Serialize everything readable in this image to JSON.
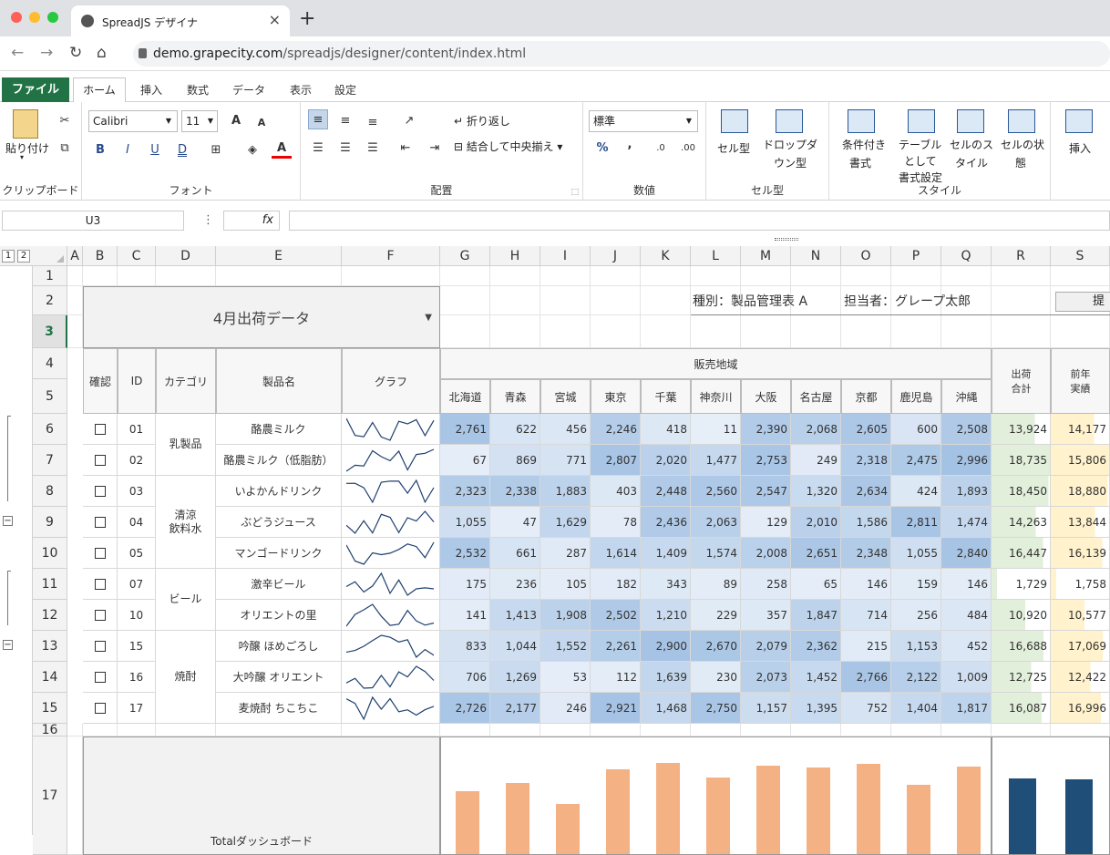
{
  "browser": {
    "tab_title": "SpreadJS デザイナ",
    "url_host": "demo.grapecity.com",
    "url_path": "/spreadjs/designer/content/index.html"
  },
  "menu": {
    "file": "ファイル",
    "tabs": [
      "ホーム",
      "挿入",
      "数式",
      "データ",
      "表示",
      "設定"
    ]
  },
  "ribbon": {
    "clipboard": {
      "paste": "貼り付け",
      "label": "クリップボード"
    },
    "font": {
      "name": "Calibri",
      "size": "11",
      "label": "フォント",
      "bold": "B",
      "italic": "I",
      "underline": "U",
      "dunderline": "D",
      "grow": "A",
      "shrink": "A"
    },
    "alignment": {
      "wrap": "折り返し",
      "merge": "結合して中央揃え",
      "label": "配置"
    },
    "number": {
      "format": "標準",
      "percent": "%",
      "comma": ",",
      "label": "数値"
    },
    "celltype": {
      "cell": "セル型",
      "dropdown1": "ドロップダ",
      "dropdown2": "ウン型",
      "label": "セル型"
    },
    "style": {
      "cond1": "条件付き",
      "cond2": "書式",
      "table1": "テーブル",
      "table2": "として",
      "table3": "書式設定",
      "cellstyle1": "セルのス",
      "cellstyle2": "タイル",
      "state1": "セルの状",
      "state2": "態",
      "label": "スタイル"
    },
    "insert": {
      "label": "挿入"
    }
  },
  "formula": {
    "namebox": "U3",
    "fx": "fx",
    "colon": "⋮"
  },
  "columns": [
    "A",
    "B",
    "C",
    "D",
    "E",
    "F",
    "G",
    "H",
    "I",
    "J",
    "K",
    "L",
    "M",
    "N",
    "O",
    "P",
    "Q",
    "R",
    "S"
  ],
  "rows": [
    "1",
    "2",
    "3",
    "4",
    "5",
    "6",
    "7",
    "8",
    "9",
    "10",
    "11",
    "12",
    "13",
    "14",
    "15",
    "16",
    "17"
  ],
  "outline": [
    "1",
    "2"
  ],
  "sheet": {
    "title": "4月出荷データ",
    "kind": "種別：製品管理表 A",
    "person": "担当者：グレープ太郎",
    "btn": "提",
    "headers": {
      "check": "確認",
      "id": "ID",
      "category": "カテゴリ",
      "product": "製品名",
      "graph": "グラフ",
      "region": "販売地域",
      "total1": "出荷",
      "total2": "合計",
      "prev1": "前年",
      "prev2": "実績"
    },
    "regions": [
      "北海道",
      "青森",
      "宮城",
      "東京",
      "千葉",
      "神奈川",
      "大阪",
      "名古屋",
      "京都",
      "鹿児島",
      "沖縄"
    ],
    "categories": [
      {
        "name": "乳製品",
        "rows": 2
      },
      {
        "name": "清涼\n飲料水",
        "rows": 3
      },
      {
        "name": "ビール",
        "rows": 2
      },
      {
        "name": "焼酎",
        "rows": 3
      }
    ],
    "products": [
      {
        "id": "01",
        "name": "酪農ミルク",
        "vals": [
          "2,761",
          "622",
          "456",
          "2,246",
          "418",
          "11",
          "2,390",
          "2,068",
          "2,605",
          "600",
          "2,508"
        ],
        "total": "13,924",
        "prev": "14,177"
      },
      {
        "id": "02",
        "name": "酪農ミルク（低脂肪）",
        "vals": [
          "67",
          "869",
          "771",
          "2,807",
          "2,020",
          "1,477",
          "2,753",
          "249",
          "2,318",
          "2,475",
          "2,996"
        ],
        "total": "18,735",
        "prev": "15,806"
      },
      {
        "id": "03",
        "name": "いよかんドリンク",
        "vals": [
          "2,323",
          "2,338",
          "1,883",
          "403",
          "2,448",
          "2,560",
          "2,547",
          "1,320",
          "2,634",
          "424",
          "1,893"
        ],
        "total": "18,450",
        "prev": "18,880"
      },
      {
        "id": "04",
        "name": "ぶどうジュース",
        "vals": [
          "1,055",
          "47",
          "1,629",
          "78",
          "2,436",
          "2,063",
          "129",
          "2,010",
          "1,586",
          "2,811",
          "1,474"
        ],
        "total": "14,263",
        "prev": "13,844"
      },
      {
        "id": "05",
        "name": "マンゴードリンク",
        "vals": [
          "2,532",
          "661",
          "287",
          "1,614",
          "1,409",
          "1,574",
          "2,008",
          "2,651",
          "2,348",
          "1,055",
          "2,840"
        ],
        "total": "16,447",
        "prev": "16,139"
      },
      {
        "id": "07",
        "name": "激辛ビール",
        "vals": [
          "175",
          "236",
          "105",
          "182",
          "343",
          "89",
          "258",
          "65",
          "146",
          "159",
          "146"
        ],
        "total": "1,729",
        "prev": "1,758"
      },
      {
        "id": "10",
        "name": "オリエントの里",
        "vals": [
          "141",
          "1,413",
          "1,908",
          "2,502",
          "1,210",
          "229",
          "357",
          "1,847",
          "714",
          "256",
          "484"
        ],
        "total": "10,920",
        "prev": "10,577"
      },
      {
        "id": "15",
        "name": "吟醸 ほめごろし",
        "vals": [
          "833",
          "1,044",
          "1,552",
          "2,261",
          "2,900",
          "2,670",
          "2,079",
          "2,362",
          "215",
          "1,153",
          "452"
        ],
        "total": "16,688",
        "prev": "17,069"
      },
      {
        "id": "16",
        "name": "大吟醸 オリエント",
        "vals": [
          "706",
          "1,269",
          "53",
          "112",
          "1,639",
          "230",
          "2,073",
          "1,452",
          "2,766",
          "2,122",
          "1,009"
        ],
        "total": "12,725",
        "prev": "12,422"
      },
      {
        "id": "17",
        "name": "麦焼酎 ちこちこ",
        "vals": [
          "2,726",
          "2,177",
          "246",
          "2,921",
          "1,468",
          "2,750",
          "1,157",
          "1,395",
          "752",
          "1,404",
          "1,817"
        ],
        "total": "16,087",
        "prev": "16,996"
      }
    ],
    "dashboard": "Totalダッシュボード"
  },
  "chart_data": {
    "type": "bar",
    "categories": [
      "北海道",
      "青森",
      "宮城",
      "東京",
      "千葉",
      "神奈川",
      "大阪",
      "名古屋",
      "京都",
      "鹿児島",
      "沖縄"
    ],
    "values": [
      11319,
      12676,
      8880,
      15126,
      16291,
      13651,
      15751,
      15419,
      16084,
      12459,
      15619
    ],
    "series_totals": [
      139968,
      137668
    ]
  },
  "colors": {
    "accent": "#217346",
    "heat_high": "#a4c2e4",
    "heat_low": "#e6eef8",
    "total_bar": "#e2efda",
    "prev_bar": "#fff2cc",
    "chart_bar": "#f4b183",
    "chart_dark": "#1f4e79"
  }
}
